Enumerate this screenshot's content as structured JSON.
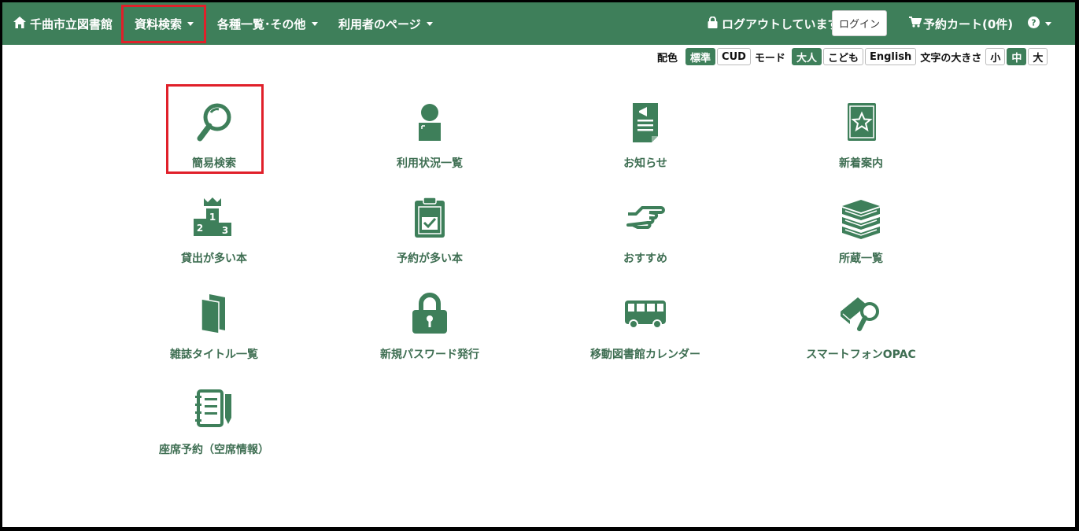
{
  "navbar": {
    "home_label": "千曲市立図書館",
    "menu_search": "資料検索",
    "menu_lists": "各種一覧･その他",
    "menu_user": "利用者のページ",
    "logout_status": "ログアウトしています",
    "login_button": "ログイン",
    "cart_label": "予約カート(0件)",
    "help_icon": "question-circle-icon",
    "highlight_color": "#e0202a",
    "bar_color": "#3e7f5a"
  },
  "settings": {
    "color_label": "配色",
    "color_options": [
      "標準",
      "CUD"
    ],
    "color_selected": "標準",
    "mode_label": "モード",
    "mode_options": [
      "大人",
      "こども",
      "English"
    ],
    "mode_selected": "大人",
    "size_label": "文字の大きさ",
    "size_options": [
      "小",
      "中",
      "大"
    ],
    "size_selected": "中"
  },
  "tiles": [
    {
      "label": "簡易検索",
      "icon": "magnifier-icon",
      "highlighted": true
    },
    {
      "label": "利用状況一覧",
      "icon": "user-icon"
    },
    {
      "label": "お知らせ",
      "icon": "notice-document-icon"
    },
    {
      "label": "新着案内",
      "icon": "star-book-icon"
    },
    {
      "label": "貸出が多い本",
      "icon": "ranking-podium-icon"
    },
    {
      "label": "予約が多い本",
      "icon": "clipboard-check-icon"
    },
    {
      "label": "おすすめ",
      "icon": "pointing-hand-icon"
    },
    {
      "label": "所蔵一覧",
      "icon": "book-stack-icon"
    },
    {
      "label": "雑誌タイトル一覧",
      "icon": "magazine-icon"
    },
    {
      "label": "新規パスワード発行",
      "icon": "padlock-icon"
    },
    {
      "label": "移動図書館カレンダー",
      "icon": "bus-icon"
    },
    {
      "label": "スマートフォンOPAC",
      "icon": "book-search-icon"
    },
    {
      "label": "座席予約（空席情報）",
      "icon": "notebook-pen-icon"
    }
  ]
}
